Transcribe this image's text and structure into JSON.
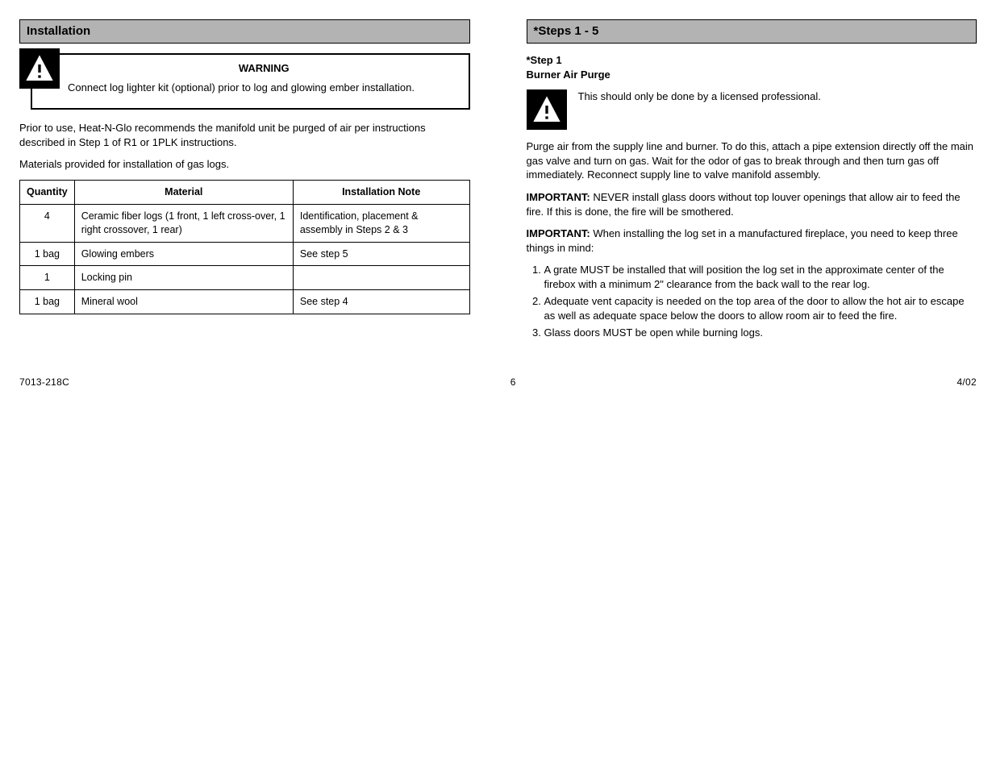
{
  "left": {
    "header": "Installation",
    "warn_title": "WARNING",
    "warn_text": "Connect log lighter kit (optional) prior to log and glowing ember installation.",
    "intro1": "Prior to use, Heat-N-Glo recommends the manifold unit be purged of air per instructions described in Step 1 of R1 or 1PLK instructions.",
    "intro2": "Materials provided for installation of gas logs.",
    "table": {
      "headers": [
        "Quantity",
        "Material",
        "Installation Note"
      ],
      "rows": [
        {
          "qty": "4",
          "mat": "Ceramic fiber logs (1 front, 1 left cross-over, 1 right crossover, 1 rear)",
          "note": "Identification, placement & assembly in Steps 2 & 3"
        },
        {
          "qty": "1 bag",
          "mat": "Glowing embers",
          "note": "See step 5"
        },
        {
          "qty": "1",
          "mat": "Locking pin",
          "note": ""
        },
        {
          "qty": "1 bag",
          "mat": "Mineral wool",
          "note": "See step 4"
        }
      ]
    }
  },
  "right": {
    "header": "*Steps 1 - 5",
    "step1_title": "*Step 1",
    "step1_sub": "Burner Air Purge",
    "warn_text": "This should only be done by a licensed professional.",
    "block1": "Purge air from the supply line and burner. To do this, attach a pipe extension directly off the main gas valve and turn on gas. Wait for the odor of gas to break through and then turn gas off immediately. Reconnect supply line to valve manifold assembly.",
    "block2_label": "IMPORTANT:",
    "block2_text": " NEVER install glass doors without top louver openings that allow air to feed the fire. If this is done, the fire will be smothered.",
    "block3_label": "IMPORTANT:",
    "block3_text": " When installing the log set in a manufactured fireplace, you need to keep three things in mind:",
    "list": [
      "A grate MUST be installed that will position the log set in the approximate center of the firebox with a minimum 2\" clearance from the back wall to the rear log.",
      "Adequate vent capacity is needed on the top area of the door to allow the hot air to escape as well as adequate space below the doors to allow room air to feed the fire.",
      "Glass doors MUST be open while burning logs."
    ]
  },
  "footer": {
    "part_no": "7013-218C",
    "page": "6",
    "date": "4/02"
  }
}
